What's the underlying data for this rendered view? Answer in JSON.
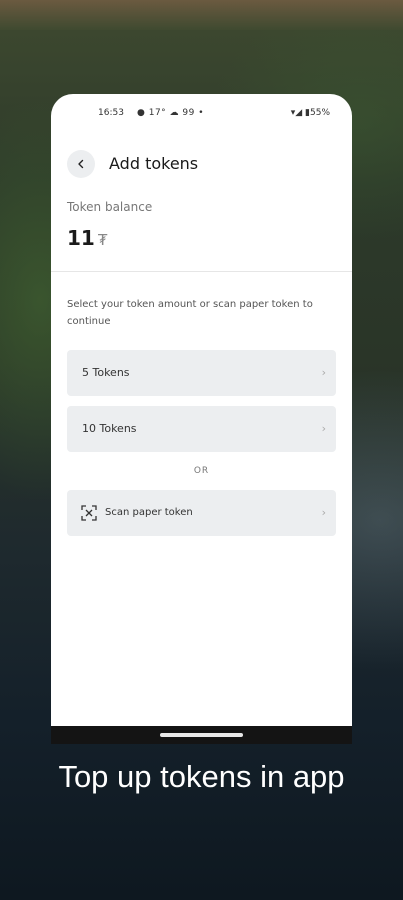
{
  "status_bar": {
    "time": "16:53",
    "indicators": "● 17° ☁ 99 •",
    "battery": "▾◢ ▮55%"
  },
  "header": {
    "back_icon": "chevron-left-icon",
    "title": "Add tokens"
  },
  "balance": {
    "label": "Token balance",
    "value": "11",
    "unit": "₮"
  },
  "instruction": "Select your token amount or scan paper token to continue",
  "options": [
    {
      "label": "5 Tokens"
    },
    {
      "label": "10 Tokens"
    }
  ],
  "separator": "OR",
  "scan": {
    "label": "Scan paper token",
    "icon": "scan-icon"
  },
  "chevron": "›",
  "caption": "Top up tokens in app"
}
